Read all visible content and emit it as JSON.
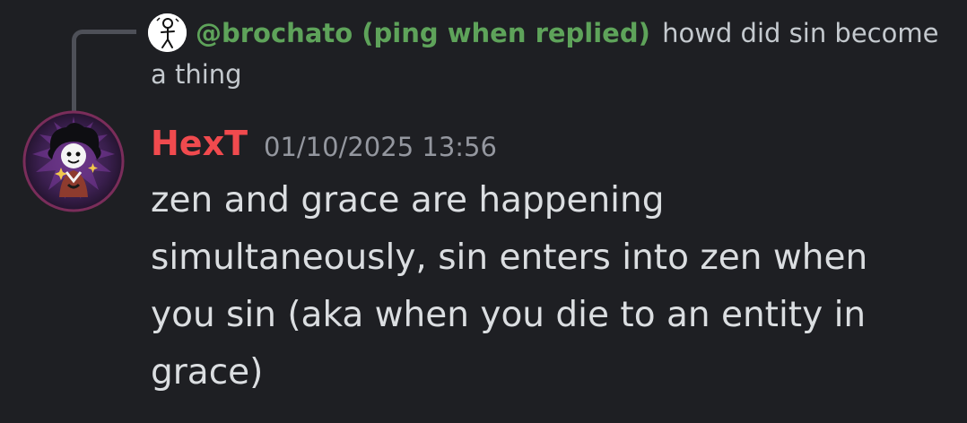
{
  "reply": {
    "author": "@brochato (ping when replied)",
    "content": "howd did sin become a thing",
    "author_color": "#5ea35a"
  },
  "message": {
    "author": "HexT",
    "author_color": "#f04a4e",
    "timestamp": "01/10/2025 13:56",
    "content": "zen and grace are happening\nsimultaneously, sin enters into zen when\nyou sin (aka when you die to an entity in\ngrace)"
  },
  "icons": {
    "reply_avatar": "stick-figure-avatar-icon",
    "author_avatar": "character-avatar-icon"
  }
}
